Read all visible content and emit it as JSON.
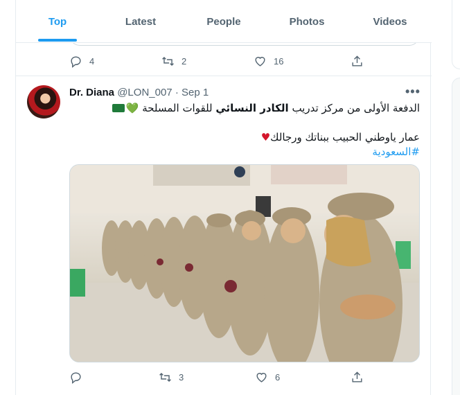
{
  "tabs": [
    {
      "label": "Top",
      "active": true
    },
    {
      "label": "Latest",
      "active": false
    },
    {
      "label": "People",
      "active": false
    },
    {
      "label": "Photos",
      "active": false
    },
    {
      "label": "Videos",
      "active": false
    }
  ],
  "prev_tweet": {
    "reply_count": "4",
    "retweet_count": "2",
    "like_count": "16"
  },
  "tweet": {
    "author_name": "Dr. Diana",
    "author_handle": "@LON_007",
    "separator": "·",
    "date": "Sep 1",
    "more_label": "•••",
    "text_line1_start": "الدفعة الأولى من مركز تدريب ",
    "text_line1_bold": "الكادر النسائي",
    "text_line1_end": " للقوات المسلحة ",
    "text_line2": "عمار ياوطني الحبيب ببناتك ورجالك",
    "hashtag": "#السعودية",
    "green_heart": "💚",
    "red_heart": "♥",
    "reply_count": "",
    "retweet_count": "3",
    "like_count": "6"
  },
  "colors": {
    "accent": "#1d9bf0",
    "muted": "#536471",
    "border": "#e6ecf0"
  },
  "icons": [
    "reply-icon",
    "retweet-icon",
    "like-icon",
    "share-icon",
    "more-icon",
    "saudi-flag-icon"
  ]
}
